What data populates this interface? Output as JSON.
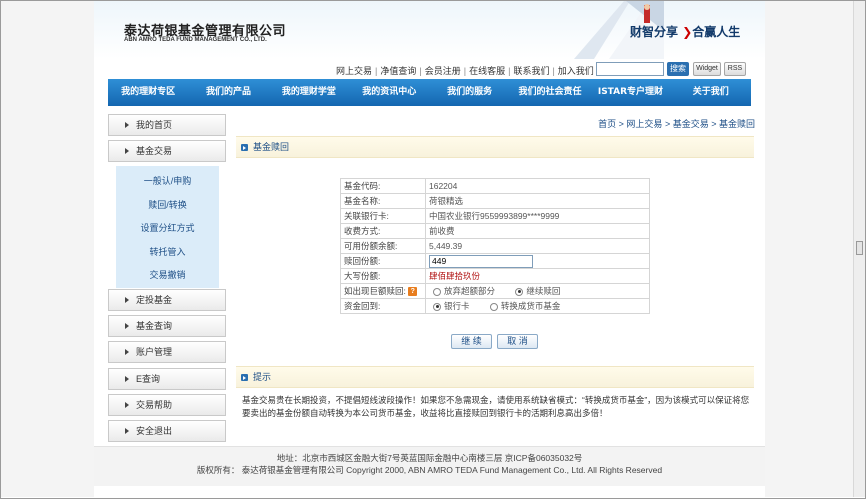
{
  "header": {
    "logo_cn": "泰达荷银基金管理有限公司",
    "logo_en": "ABN AMRO TEDA FUND MANAGEMENT CO., LTD.",
    "slogan_left": "财智分享",
    "slogan_right": "合赢人生"
  },
  "toplinks": {
    "items": [
      "网上交易",
      "净值查询",
      "会员注册",
      "在线客服",
      "联系我们",
      "加入我们"
    ],
    "search_label": "搜索",
    "widget_label": "Widget",
    "rss_label": "RSS"
  },
  "nav": {
    "items": [
      "我的理财专区",
      "我们的产品",
      "我的理财学堂",
      "我的资讯中心",
      "我们的服务",
      "我们的社会责任",
      "ISTAR专户理财",
      "关于我们"
    ]
  },
  "sidemenu": {
    "items": [
      "我的首页",
      "基金交易",
      "定投基金",
      "基金查询",
      "账户管理",
      "E查询",
      "交易帮助",
      "安全退出"
    ],
    "sub_items": [
      "一般认/申购",
      "赎回/转换",
      "设置分红方式",
      "转托管入",
      "交易撤销"
    ]
  },
  "breadcrumb": {
    "items": [
      "首页",
      "网上交易",
      "基金交易",
      "基金赎回"
    ],
    "separator": " > "
  },
  "section": {
    "title": "基金赎回",
    "tip_title": "提示"
  },
  "form": {
    "rows": [
      {
        "label": "基金代码:",
        "value": "162204"
      },
      {
        "label": "基金名称:",
        "value": "荷银精选"
      },
      {
        "label": "关联银行卡:",
        "value": "中国农业银行9559993899****9999"
      },
      {
        "label": "收费方式:",
        "value": "前收费"
      },
      {
        "label": "可用份额余额:",
        "value": "5,449.39"
      }
    ],
    "redeem_label": "赎回份额:",
    "redeem_value": "449",
    "uppercase_label": "大写份额:",
    "uppercase_value": "肆佰肆拾玖份",
    "large_label": "如出现巨额赎回:",
    "large_opt1": "放弃超额部分",
    "large_opt2": "继续赎回",
    "large_selected": "继续赎回",
    "dest_label": "资金回到:",
    "dest_opt1": "银行卡",
    "dest_opt2": "转换成货币基金",
    "dest_selected": "银行卡",
    "continue_label": "继 续",
    "cancel_label": "取 消"
  },
  "tip": {
    "text": "基金交易贵在长期投资，不提倡短线波段操作！如果您不急需现金，请使用系统缺省模式：“转换成货币基金”，因为该模式可以保证将您要卖出的基金份额自动转换为本公司货币基金，收益将比直接赎回到银行卡的活期利息高出多倍！"
  },
  "footer": {
    "address": "地址：北京市西城区金融大街7号英蓝国际金融中心南楼三层 京ICP备06035032号",
    "copyright": "版权所有：  泰达荷银基金管理有限公司  Copyright 2000, ABN AMRO TEDA Fund Management Co., Ltd. All Rights Reserved"
  },
  "colors": {
    "nav_blue": "#1a74c0",
    "link_blue": "#1d4e86",
    "accent_red": "#b01010"
  }
}
